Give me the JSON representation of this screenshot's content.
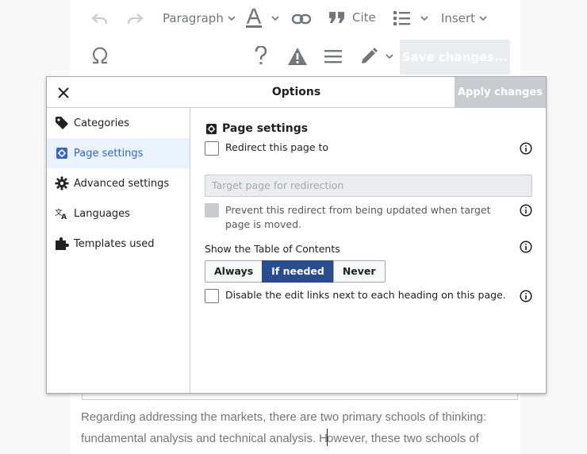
{
  "toolbar": {
    "paragraph_label": "Paragraph",
    "cite_label": "Cite",
    "insert_label": "Insert",
    "save_label": "Save changes..."
  },
  "dialog": {
    "title": "Options",
    "apply_label": "Apply changes"
  },
  "sidebar": {
    "items": [
      {
        "label": "Categories",
        "icon": "tag-icon"
      },
      {
        "label": "Page settings",
        "icon": "settings-icon",
        "active": true
      },
      {
        "label": "Advanced settings",
        "icon": "gear-icon"
      },
      {
        "label": "Languages",
        "icon": "language-icon"
      },
      {
        "label": "Templates used",
        "icon": "puzzle-icon"
      }
    ]
  },
  "panel": {
    "title": "Page settings",
    "redirect_label": "Redirect this page to",
    "target_placeholder": "Target page for redirection",
    "prevent_redirect_label": "Prevent this redirect from being updated when target page is moved.",
    "toc_label": "Show the Table of Contents",
    "toc_options": [
      "Always",
      "If needed",
      "Never"
    ],
    "toc_selected": "If needed",
    "disable_edit_links_label": "Disable the edit links next to each heading on this page."
  },
  "page": {
    "text_line1": "Regarding addressing the markets, there are two primary schools of thinking:",
    "text_line2a": "fundamental analysis and technical analysis. H",
    "text_line2b": "owever, these two schools of"
  },
  "colors": {
    "accent": "#3366cc",
    "selected_bg": "#2a4b8d",
    "border": "#c8ccd1"
  }
}
